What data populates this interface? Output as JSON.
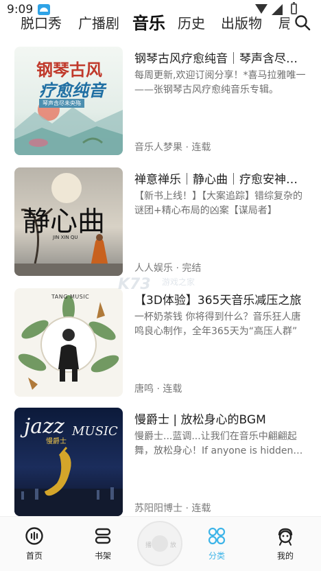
{
  "status_bar": {
    "time": "9:09"
  },
  "tabs": [
    {
      "label": "脱口秀",
      "active": false
    },
    {
      "label": "广播剧",
      "active": false
    },
    {
      "label": "音乐",
      "active": true
    },
    {
      "label": "历史",
      "active": false
    },
    {
      "label": "出版物",
      "active": false
    },
    {
      "label": "局",
      "active": false
    }
  ],
  "search_icon": "search-icon",
  "books": [
    {
      "title": "钢琴古风疗愈纯音｜琴声含尽人间情",
      "desc": "每周更新,欢迎订阅分享！*喜马拉雅唯一——张钢琴古风疗愈纯音乐专辑。",
      "meta": "音乐人梦果 · 连载",
      "cover_text": {
        "line1": "钢琴古风",
        "line2": "疗愈纯音",
        "tag": "琴声含尽未央殇"
      }
    },
    {
      "title": "禅意禅乐｜静心曲｜疗愈安神助眠",
      "desc": "【新书上线！】【大案追踪】错综复杂的谜团+精心布局的凶案【谋局者】",
      "meta": "人人娱乐 · 完结",
      "cover_text": {
        "main": "静心曲",
        "sub": "JIN XIN QU"
      }
    },
    {
      "title": "【3D体验】365天音乐减压之旅",
      "desc": "一杯奶茶钱 你将得到什么？音乐狂人唐鸣良心制作，全年365天为“高压人群”",
      "meta": "唐鸣 · 连载",
      "cover_text": {
        "brand": "TANG MUSIC"
      }
    },
    {
      "title": "慢爵士 | 放松身心的BGM",
      "desc": "慢爵士...蓝调...让我们在音乐中翩翩起舞，放松身心！If anyone is hidden away",
      "meta": "苏阳阳博士 · 连载",
      "cover_text": {
        "jazz": "jazz",
        "music": "MUSIC",
        "cn": "慢爵士"
      }
    }
  ],
  "watermark": {
    "logo": "K73",
    "site": "游戏之家"
  },
  "bottom_nav": [
    {
      "label": "首页",
      "icon": "home-icon",
      "active": false
    },
    {
      "label": "书架",
      "icon": "bookshelf-icon",
      "active": false
    },
    {
      "label": "分类",
      "icon": "category-icon",
      "active": true
    },
    {
      "label": "我的",
      "icon": "profile-icon",
      "active": false
    }
  ],
  "player": {
    "left_text": "播",
    "right_text": "放"
  },
  "colors": {
    "accent": "#3db4e8",
    "text": "#1e1e1e",
    "secondary": "#6e6e6e"
  }
}
